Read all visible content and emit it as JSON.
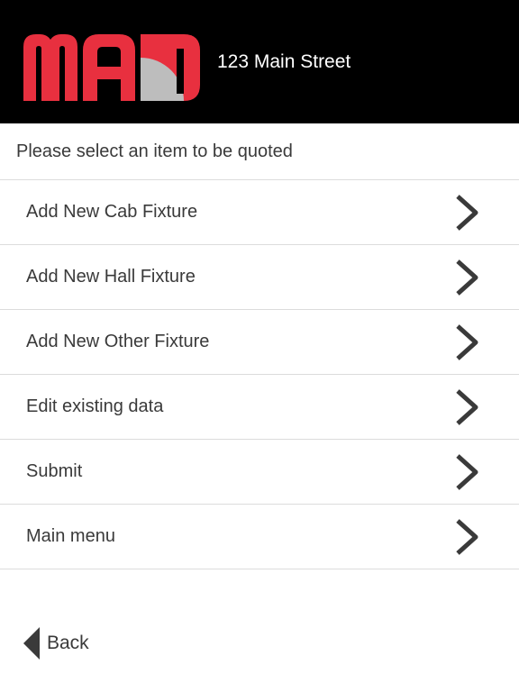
{
  "header": {
    "logo": {
      "text": "MAD",
      "primary_color": "#e8303f",
      "secondary_color": "#bdbdbd"
    },
    "address": "123 Main Street",
    "background_color": "#000000"
  },
  "prompt": "Please select an item to be quoted",
  "menu": {
    "items": [
      {
        "label": "Add New Cab Fixture",
        "icon": "chevron-right-icon"
      },
      {
        "label": "Add New Hall Fixture",
        "icon": "chevron-right-icon"
      },
      {
        "label": "Add New Other Fixture",
        "icon": "chevron-right-icon"
      },
      {
        "label": "Edit existing data",
        "icon": "chevron-right-icon"
      },
      {
        "label": "Submit",
        "icon": "chevron-right-icon"
      },
      {
        "label": "Main menu",
        "icon": "chevron-right-icon"
      }
    ]
  },
  "footer": {
    "back_label": "Back",
    "back_icon": "triangle-left-icon"
  },
  "colors": {
    "text": "#3a3a3a",
    "divider": "#dcdcdc",
    "chevron": "#3a3a3a"
  }
}
